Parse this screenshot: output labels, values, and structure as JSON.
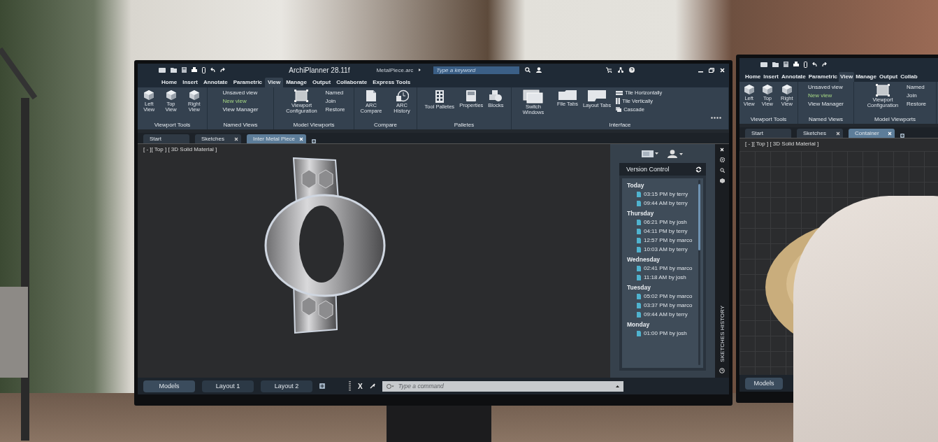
{
  "main_monitor": {
    "app_title": "ArchiPlanner 28.11f",
    "file_name": "MetalPiece.arc",
    "search": {
      "placeholder": "Type a keyword"
    },
    "menu_tabs": [
      {
        "label": "Home",
        "selected": false
      },
      {
        "label": "Insert",
        "selected": false
      },
      {
        "label": "Annotate",
        "selected": false
      },
      {
        "label": "Parametric",
        "selected": false
      },
      {
        "label": "View",
        "selected": true
      },
      {
        "label": "Manage",
        "selected": false
      },
      {
        "label": "Output",
        "selected": false
      },
      {
        "label": "Collaborate",
        "selected": false
      },
      {
        "label": "Express Tools",
        "selected": false
      }
    ],
    "ribbon_groups": [
      {
        "title": "Viewport Tools",
        "items": [
          {
            "kind": "view-cube",
            "label": "Left View"
          },
          {
            "kind": "view-cube",
            "label": "Top View"
          },
          {
            "kind": "view-cube",
            "label": "Right View"
          }
        ]
      },
      {
        "title": "Named Views",
        "items": [
          {
            "kind": "text",
            "label": "Unsaved view",
            "highlighted": false
          },
          {
            "kind": "text",
            "label": "New view",
            "highlighted": true
          },
          {
            "kind": "text",
            "label": "View Manager",
            "highlighted": false
          }
        ]
      },
      {
        "title": "Model Viewports",
        "items": [
          {
            "kind": "viewport",
            "label": "Viewport Configuration"
          },
          {
            "kind": "text",
            "label": "Named"
          },
          {
            "kind": "text",
            "label": "Join"
          },
          {
            "kind": "text",
            "label": "Restore"
          }
        ]
      },
      {
        "title": "Compare",
        "items": [
          {
            "kind": "document",
            "label": "ARC Compare"
          },
          {
            "kind": "history",
            "label": "ARC History"
          }
        ]
      },
      {
        "title": "Palletes",
        "items": [
          {
            "kind": "palette",
            "label": "Tool Palletes"
          },
          {
            "kind": "properties",
            "label": "Properties"
          },
          {
            "kind": "blocks",
            "label": "Blocks"
          }
        ]
      },
      {
        "title": "Interface",
        "items": [
          {
            "kind": "windows",
            "label": "Switch Windows"
          },
          {
            "kind": "folder",
            "label": "File Tabs"
          },
          {
            "kind": "layout",
            "label": "Layout Tabs"
          },
          {
            "kind": "tile-h",
            "label": "Tile Horizontally"
          },
          {
            "kind": "tile-v",
            "label": "Tile Vertically"
          },
          {
            "kind": "cascade",
            "label": "Cascade"
          }
        ]
      }
    ],
    "doc_tabs": [
      {
        "label": "Start",
        "selected": false,
        "closable": false
      },
      {
        "label": "Sketches",
        "selected": false,
        "closable": true
      },
      {
        "label": "Inter Metal Piece",
        "selected": true,
        "closable": true
      }
    ],
    "viewport_label": "[ - ][ Top ] [ 3D Solid Material ]",
    "version_control": {
      "title": "Version Control",
      "side_label": "SKETCHES HISTORY",
      "groups": [
        {
          "day": "Today",
          "entries": [
            "03:15 PM by terry",
            "09:44 AM by terry"
          ]
        },
        {
          "day": "Thursday",
          "entries": [
            "06:21 PM by josh",
            "04:11 PM by terry",
            "12:57 PM by marco",
            "10:03 AM by terry"
          ]
        },
        {
          "day": "Wednesday",
          "entries": [
            "02:41 PM by marco",
            "11:18 AM by josh"
          ]
        },
        {
          "day": "Tuesday",
          "entries": [
            "05:02 PM by marco",
            "03:37 PM by marco",
            "09:44 AM by terry"
          ]
        },
        {
          "day": "Monday",
          "entries": [
            "01:00 PM by josh"
          ]
        }
      ]
    },
    "layout_tabs": [
      {
        "label": "Models",
        "selected": true
      },
      {
        "label": "Layout 1",
        "selected": false
      },
      {
        "label": "Layout 2",
        "selected": false
      }
    ],
    "command_close": "X",
    "command": {
      "placeholder": "Type a command"
    }
  },
  "second_monitor": {
    "menu_tabs": [
      {
        "label": "Home",
        "selected": false
      },
      {
        "label": "Insert",
        "selected": false
      },
      {
        "label": "Annotate",
        "selected": false
      },
      {
        "label": "Parametric",
        "selected": false
      },
      {
        "label": "View",
        "selected": true
      },
      {
        "label": "Manage",
        "selected": false
      },
      {
        "label": "Output",
        "selected": false
      },
      {
        "label": "Collab",
        "selected": false
      }
    ],
    "ribbon_groups": [
      {
        "title": "Viewport Tools",
        "items": [
          {
            "kind": "view-cube",
            "label": "Left View"
          },
          {
            "kind": "view-cube",
            "label": "Top View"
          },
          {
            "kind": "view-cube",
            "label": "Right View"
          }
        ]
      },
      {
        "title": "Named Views",
        "items": [
          {
            "kind": "text",
            "label": "Unsaved view",
            "highlighted": false
          },
          {
            "kind": "text",
            "label": "New view",
            "highlighted": true
          },
          {
            "kind": "text",
            "label": "View Manager",
            "highlighted": false
          }
        ]
      },
      {
        "title": "Model Viewports",
        "items": [
          {
            "kind": "viewport",
            "label": "Viewport Configuration"
          },
          {
            "kind": "text",
            "label": "Named"
          },
          {
            "kind": "text",
            "label": "Join"
          },
          {
            "kind": "text",
            "label": "Restore"
          }
        ]
      }
    ],
    "doc_tabs": [
      {
        "label": "Start",
        "selected": false,
        "closable": false
      },
      {
        "label": "Sketches",
        "selected": false,
        "closable": true
      },
      {
        "label": "Container",
        "selected": true,
        "closable": true
      }
    ],
    "viewport_label": "[ - ][ Top ] [ 3D Solid Material ]",
    "layout_tabs": [
      {
        "label": "Models",
        "selected": true
      }
    ]
  }
}
